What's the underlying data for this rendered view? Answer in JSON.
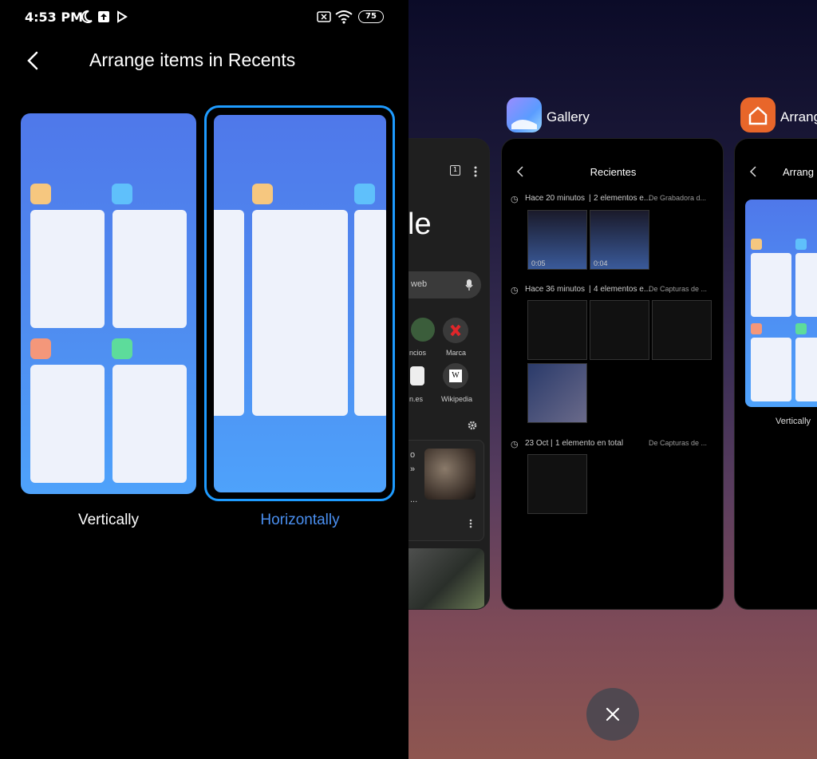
{
  "status": {
    "time": "4:53 PM",
    "battery": "75"
  },
  "header": {
    "title": "Arrange items in Recents"
  },
  "options": {
    "vertical_label": "Vertically",
    "horizontal_label": "Horizontally",
    "selected": "Horizontally"
  },
  "colors": {
    "accent": "#1e9bff",
    "selected_label": "#4a8ff0",
    "chip_yellow": "#f6c77f",
    "chip_blue": "#5fc0fb",
    "chip_orange": "#f4977a",
    "chip_green": "#5ddc9b"
  },
  "recents": {
    "gallery": {
      "app_name": "Gallery",
      "title": "Recientes",
      "groups": [
        {
          "time": "Hace 20 minutos",
          "count": "2 elementos e...",
          "source": "De Grabadora d...",
          "durations": [
            "0:05",
            "0:04"
          ]
        },
        {
          "time": "Hace 36 minutos",
          "count": "4 elementos e...",
          "source": "De Capturas de ..."
        },
        {
          "time": "23 Oct",
          "count": "1 elemento en total",
          "source": "De Capturas de ..."
        }
      ]
    },
    "chrome": {
      "tab_count": "1",
      "logo_partial": "le",
      "search_partial": "web",
      "shortcuts": [
        "ncios",
        "Marca",
        "n.es",
        "Wikipedia"
      ],
      "article_partial": [
        "o",
        "»",
        "..."
      ]
    },
    "settings": {
      "app_name": "Arrang",
      "title_partial": "Arrang",
      "vertical_label": "Vertically"
    }
  }
}
